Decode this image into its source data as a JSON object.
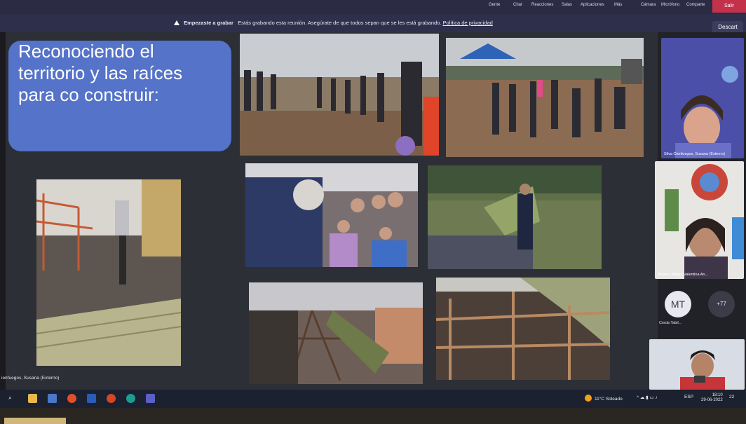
{
  "topbar": {
    "menu": [
      "Gente",
      "Chat",
      "Reacciones",
      "Salas",
      "Aplicaciones",
      "Más",
      "Cámara",
      "Micrófono",
      "Comparte"
    ],
    "end_label": "Salir"
  },
  "banner": {
    "title": "Empezaste a grabar",
    "message": "Estás grabando esta reunión. Asegúrate de que todos sepan que se les está grabando.",
    "link": "Política de privacidad",
    "discard": "Descart"
  },
  "slide": {
    "title": "Reconociendo  el territorio y las raíces para co construir:"
  },
  "presenter_label": "ienfuegos, Susana (Externo)",
  "participants": [
    {
      "name": "Silva Cienfuegos, Susana (Externo)"
    },
    {
      "name": "Alvarez Alfaro, Valentina An..."
    }
  ],
  "avatar": {
    "initials": "MT",
    "name": "Cerda Tabil...",
    "more": "+77"
  },
  "taskbar": {
    "weather": "11°C  Soleado",
    "lang": "ESP",
    "time": "18:10",
    "date": "29-06-2022",
    "notif": "22"
  },
  "colors": {
    "slide_title_bg": "#5473c9",
    "end_button": "#c4314b",
    "teams_bar": "#2b2c44"
  }
}
